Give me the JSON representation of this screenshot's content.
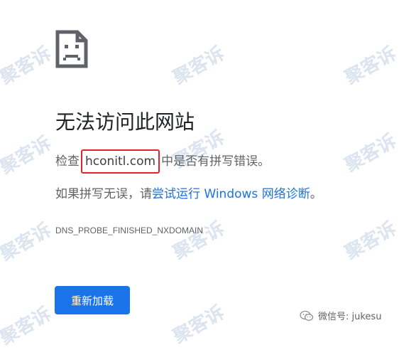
{
  "error_page": {
    "title": "无法访问此网站",
    "check_prefix": "检查",
    "domain": "hconitl.com",
    "check_suffix": "中是否有拼写错误。",
    "suggestion_prefix": "如果拼写无误，请",
    "suggestion_link": "尝试运行 Windows 网络诊断",
    "suggestion_suffix": "。",
    "error_code": "DNS_PROBE_FINISHED_NXDOMAIN",
    "reload_label": "重新加载",
    "sad_document_icon": "sad-document-icon"
  },
  "watermark": {
    "text": "聚客诉",
    "wechat_label": "微信号: jukesu",
    "wechat_icon": "wechat-icon"
  },
  "colors": {
    "link": "#1a73e8",
    "button": "#1a73e8",
    "highlight_box": "#e3232b"
  }
}
